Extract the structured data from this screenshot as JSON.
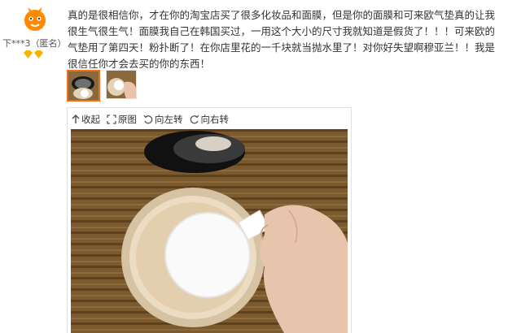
{
  "user": {
    "name": "下***3（匿名）"
  },
  "review": {
    "text": "真的是很相信你，才在你的淘宝店买了很多化妆品和面膜，但是你的面膜和可来欧气垫真的让我很生气很生气！面膜我自己在韩国买过，一用这个大小的尺寸我就知道是假货了！！！可来欧的气垫用了第四天！粉扑断了！在你店里花的一千块就当抛水里了！对你好失望啊穆亚兰！！我是很信任你才会去买的你的东西！"
  },
  "toolbar": {
    "collapse_label": "收起",
    "original_label": "原图",
    "rotate_left_label": "向左转",
    "rotate_right_label": "向右转"
  },
  "colors": {
    "accent": "#f26d1b",
    "avatar": "#ff8a00"
  }
}
